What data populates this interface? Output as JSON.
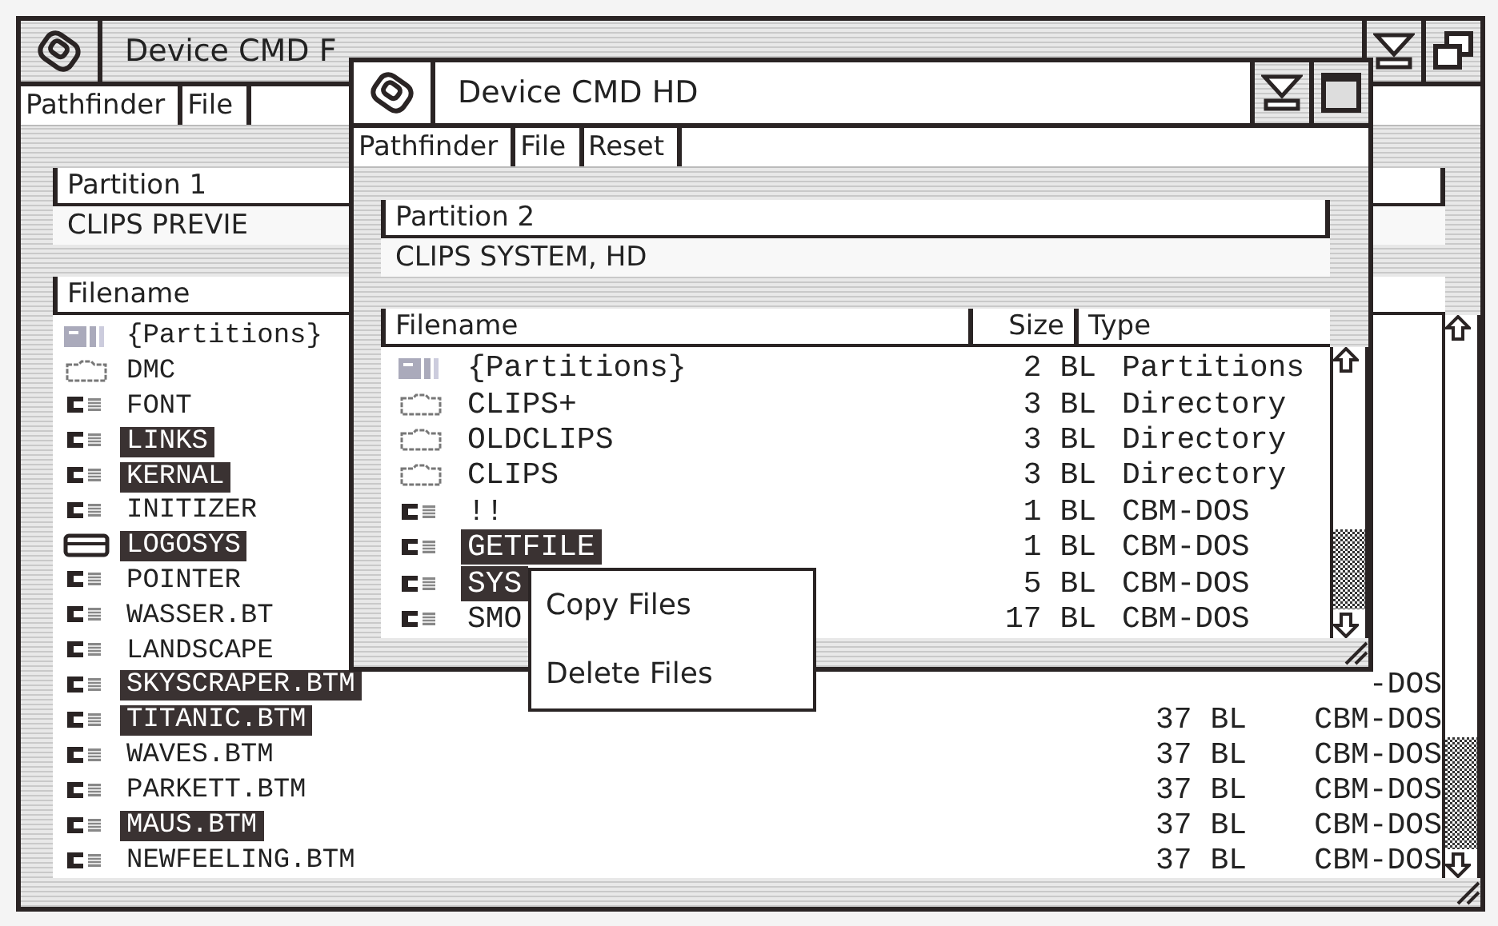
{
  "back_window": {
    "title": "Device CMD F",
    "menu": [
      {
        "label": "Pathfinder"
      },
      {
        "label": "File"
      }
    ],
    "partition": {
      "label": "Partition 1",
      "value": "CLIPS PREVIE"
    },
    "list": {
      "columns": [
        "Filename"
      ],
      "rows": [
        {
          "kind": "partitions",
          "name": "{Partitions}",
          "selected": false
        },
        {
          "kind": "folder",
          "name": "DMC",
          "selected": false
        },
        {
          "kind": "program",
          "name": "FONT",
          "selected": false
        },
        {
          "kind": "program",
          "name": "LINKS",
          "selected": true
        },
        {
          "kind": "program",
          "name": "KERNAL",
          "selected": true
        },
        {
          "kind": "program",
          "name": "INITIZER",
          "selected": false
        },
        {
          "kind": "tray",
          "name": "LOGOSYS",
          "selected": true
        },
        {
          "kind": "program",
          "name": "POINTER",
          "selected": false
        },
        {
          "kind": "program",
          "name": "WASSER.BT",
          "selected": false
        },
        {
          "kind": "program",
          "name": "LANDSCAPE",
          "selected": false
        },
        {
          "kind": "program",
          "name": "SKYSCRAPER.BTM",
          "selected": true,
          "type": "-DOS"
        },
        {
          "kind": "program",
          "name": "TITANIC.BTM",
          "selected": true,
          "size": "37 BL",
          "type": "CBM-DOS"
        },
        {
          "kind": "program",
          "name": "WAVES.BTM",
          "selected": false,
          "size": "37 BL",
          "type": "CBM-DOS"
        },
        {
          "kind": "program",
          "name": "PARKETT.BTM",
          "selected": false,
          "size": "37 BL",
          "type": "CBM-DOS"
        },
        {
          "kind": "program",
          "name": "MAUS.BTM",
          "selected": true,
          "size": "37 BL",
          "type": "CBM-DOS"
        },
        {
          "kind": "program",
          "name": "NEWFEELING.BTM",
          "selected": false,
          "size": "37 BL",
          "type": "CBM-DOS"
        }
      ]
    }
  },
  "front_window": {
    "title": "Device CMD HD",
    "menu": [
      {
        "label": "Pathfinder"
      },
      {
        "label": "File"
      },
      {
        "label": "Reset"
      }
    ],
    "partition": {
      "label": "Partition 2",
      "value": "CLIPS SYSTEM, HD"
    },
    "list": {
      "columns": [
        "Filename",
        "Size",
        "Type"
      ],
      "rows": [
        {
          "kind": "partitions",
          "name": "{Partitions}",
          "selected": false,
          "size": "2 BL",
          "type": "Partitions"
        },
        {
          "kind": "folder",
          "name": "CLIPS+",
          "selected": false,
          "size": "3 BL",
          "type": "Directory"
        },
        {
          "kind": "folder",
          "name": "OLDCLIPS",
          "selected": false,
          "size": "3 BL",
          "type": "Directory"
        },
        {
          "kind": "folder",
          "name": "CLIPS",
          "selected": false,
          "size": "3 BL",
          "type": "Directory"
        },
        {
          "kind": "program",
          "name": "!!",
          "selected": false,
          "size": "1 BL",
          "type": "CBM-DOS"
        },
        {
          "kind": "program",
          "name": "GETFILE",
          "selected": true,
          "size": "1 BL",
          "type": "CBM-DOS"
        },
        {
          "kind": "program",
          "name": "SYS",
          "selected": true,
          "size": "5 BL",
          "type": "CBM-DOS"
        },
        {
          "kind": "program",
          "name": "SMO",
          "selected": false,
          "size": "17 BL",
          "type": "CBM-DOS"
        }
      ]
    }
  },
  "context_menu": {
    "items": [
      {
        "label": "Copy Files"
      },
      {
        "label": "Delete Files"
      }
    ]
  }
}
